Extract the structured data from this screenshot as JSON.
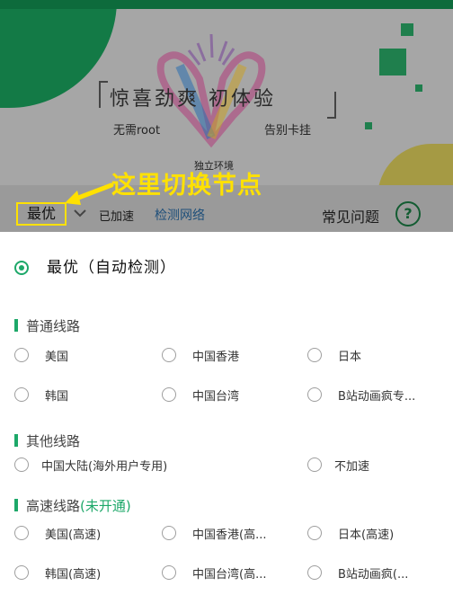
{
  "banner": {
    "headline": "惊喜劲爽  初体验",
    "tag_left": "无需root",
    "tag_right": "告别卡挂",
    "tag_bottom": "独立环境"
  },
  "annotation": {
    "text": "这里切换节点",
    "color": "#ffe100"
  },
  "node_bar": {
    "current_node": "最优",
    "status": "已加速",
    "detect_link": "检测网络",
    "faq": "常见问题",
    "help_symbol": "?"
  },
  "sheet": {
    "auto_option": {
      "label": "最优（自动检测）",
      "selected": true
    },
    "sections": [
      {
        "title": "普通线路",
        "suffix": "",
        "options": [
          "美国",
          "中国香港",
          "日本",
          "韩国",
          "中国台湾",
          "B站动画疯专..."
        ]
      },
      {
        "title": "其他线路",
        "suffix": "",
        "options": [
          "中国大陆(海外用户专用)",
          "不加速"
        ]
      },
      {
        "title": "高速线路",
        "suffix": "(未开通)",
        "options": [
          "美国(高速)",
          "中国香港(高...",
          "日本(高速)",
          "韩国(高速)",
          "中国台湾(高...",
          "B站动画疯(..."
        ]
      }
    ]
  },
  "colors": {
    "accent_green": "#1da869",
    "brand_dark_green": "#0d6b3c",
    "link_blue": "#1e4f7a"
  },
  "icons": {
    "chevron": "chevron-down-icon",
    "help": "help-circle-icon",
    "arrow": "arrow-left-icon",
    "logo": "v-heart-logo-icon"
  }
}
